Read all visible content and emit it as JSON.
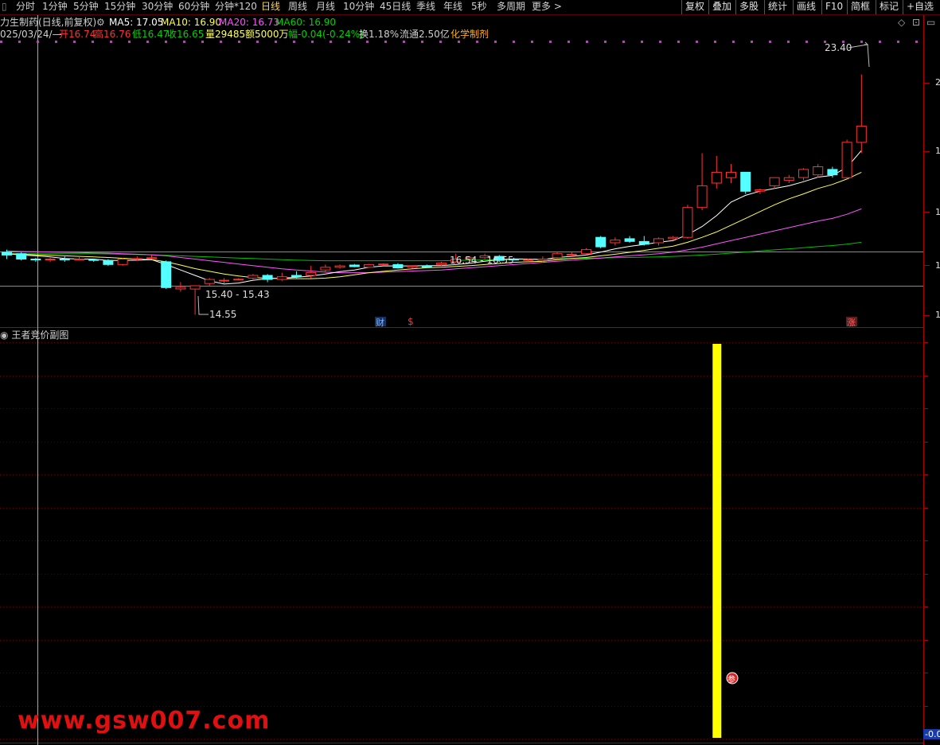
{
  "toolbar": {
    "left_items": [
      "分时",
      "1分钟",
      "5分钟",
      "15分钟",
      "30分钟",
      "60分钟",
      "分钟*120",
      "日线",
      "周线",
      "月线",
      "10分钟",
      "45日线",
      "季线",
      "年线",
      "5秒",
      "多周期",
      "更多 >"
    ],
    "active_item": "日线",
    "right_items": [
      "复权",
      "叠加",
      "多股",
      "统计",
      "画线",
      "F10",
      "简框",
      "标记",
      "+自选"
    ]
  },
  "title": {
    "stock_name": "力生制药(日线,前复权)",
    "ma5": "MA5: 17.05",
    "ma10": "MA10: 16.90",
    "ma20": "MA20: 16.73",
    "ma60": "MA60: 16.90"
  },
  "info": {
    "date": "025/03/24/—",
    "open": "开16.74",
    "high": "高16.76",
    "low": "低16.47",
    "close": "收16.65",
    "volume": "量29485",
    "amount": "额5000万",
    "change": "幅-0.04(-0.24%)",
    "turnover": "换1.18%",
    "float": "流通2.50亿",
    "sector": "化学制剂"
  },
  "annotations": {
    "high_price": "23.40",
    "low_price": "14.55",
    "range1": "15.40 - 15.43",
    "range2": "16.54 - 16.55",
    "marker_cai": "财",
    "marker_dollar": "$",
    "marker_zhang": "涨",
    "marker_shen": "参"
  },
  "right_axis": {
    "labels": [
      "2",
      "1",
      "1",
      "1",
      "1"
    ],
    "bottom_value": "-0.0"
  },
  "sub_chart": {
    "title": "王者竞价副图"
  },
  "watermark": "www.gsw007.com",
  "colors": {
    "up": "#ff3232",
    "down": "#54ffff",
    "ma5": "#ffffff",
    "ma10": "#ffff54",
    "ma20": "#ff54ff",
    "ma60": "#00c000",
    "signal_bar": "#ffff00"
  },
  "chart_data": {
    "type": "candlestick",
    "candles": [
      {
        "o": 16.85,
        "h": 16.95,
        "l": 16.6,
        "c": 16.75
      },
      {
        "o": 16.8,
        "h": 16.85,
        "l": 16.55,
        "c": 16.6
      },
      {
        "o": 16.6,
        "h": 16.65,
        "l": 16.5,
        "c": 16.58
      },
      {
        "o": 16.58,
        "h": 16.65,
        "l": 16.5,
        "c": 16.6
      },
      {
        "o": 16.6,
        "h": 16.7,
        "l": 16.5,
        "c": 16.58
      },
      {
        "o": 16.57,
        "h": 16.7,
        "l": 16.55,
        "c": 16.6
      },
      {
        "o": 16.58,
        "h": 16.62,
        "l": 16.5,
        "c": 16.55
      },
      {
        "o": 16.55,
        "h": 16.6,
        "l": 16.35,
        "c": 16.4
      },
      {
        "o": 16.4,
        "h": 16.65,
        "l": 16.35,
        "c": 16.6
      },
      {
        "o": 16.6,
        "h": 16.7,
        "l": 16.55,
        "c": 16.62
      },
      {
        "o": 16.62,
        "h": 16.75,
        "l": 16.6,
        "c": 16.65
      },
      {
        "o": 16.5,
        "h": 16.55,
        "l": 15.5,
        "c": 15.55
      },
      {
        "o": 15.5,
        "h": 15.75,
        "l": 15.4,
        "c": 15.56
      },
      {
        "o": 15.5,
        "h": 15.6,
        "l": 14.55,
        "c": 15.62
      },
      {
        "o": 15.7,
        "h": 15.9,
        "l": 15.6,
        "c": 15.85
      },
      {
        "o": 15.8,
        "h": 15.9,
        "l": 15.7,
        "c": 15.82
      },
      {
        "o": 15.85,
        "h": 15.9,
        "l": 15.82,
        "c": 15.86
      },
      {
        "o": 15.9,
        "h": 16.05,
        "l": 15.85,
        "c": 16.0
      },
      {
        "o": 16.0,
        "h": 16.05,
        "l": 15.75,
        "c": 15.85
      },
      {
        "o": 15.85,
        "h": 16.1,
        "l": 15.8,
        "c": 15.95
      },
      {
        "o": 16.0,
        "h": 16.15,
        "l": 15.9,
        "c": 15.95
      },
      {
        "o": 16.0,
        "h": 16.35,
        "l": 15.9,
        "c": 16.1
      },
      {
        "o": 16.2,
        "h": 16.4,
        "l": 16.1,
        "c": 16.3
      },
      {
        "o": 16.3,
        "h": 16.4,
        "l": 16.25,
        "c": 16.35
      },
      {
        "o": 16.38,
        "h": 16.42,
        "l": 16.3,
        "c": 16.32
      },
      {
        "o": 16.3,
        "h": 16.42,
        "l": 16.28,
        "c": 16.4
      },
      {
        "o": 16.4,
        "h": 16.45,
        "l": 16.35,
        "c": 16.42
      },
      {
        "o": 16.4,
        "h": 16.45,
        "l": 16.25,
        "c": 16.28
      },
      {
        "o": 16.3,
        "h": 16.38,
        "l": 16.25,
        "c": 16.34
      },
      {
        "o": 16.35,
        "h": 16.4,
        "l": 16.28,
        "c": 16.3
      },
      {
        "o": 16.4,
        "h": 16.5,
        "l": 16.35,
        "c": 16.45
      },
      {
        "o": 16.5,
        "h": 16.8,
        "l": 16.45,
        "c": 16.6
      },
      {
        "o": 16.6,
        "h": 16.7,
        "l": 16.55,
        "c": 16.65
      },
      {
        "o": 16.65,
        "h": 16.8,
        "l": 16.6,
        "c": 16.72
      },
      {
        "o": 16.7,
        "h": 16.75,
        "l": 16.5,
        "c": 16.55
      },
      {
        "o": 16.6,
        "h": 16.65,
        "l": 16.55,
        "c": 16.57
      },
      {
        "o": 16.55,
        "h": 16.62,
        "l": 16.5,
        "c": 16.58
      },
      {
        "o": 16.55,
        "h": 16.7,
        "l": 16.5,
        "c": 16.6
      },
      {
        "o": 16.65,
        "h": 16.85,
        "l": 16.6,
        "c": 16.8
      },
      {
        "o": 16.75,
        "h": 16.85,
        "l": 16.7,
        "c": 16.78
      },
      {
        "o": 16.8,
        "h": 17.0,
        "l": 16.75,
        "c": 16.95
      },
      {
        "o": 17.4,
        "h": 17.45,
        "l": 17.0,
        "c": 17.05
      },
      {
        "o": 17.2,
        "h": 17.4,
        "l": 17.1,
        "c": 17.3
      },
      {
        "o": 17.35,
        "h": 17.45,
        "l": 17.2,
        "c": 17.25
      },
      {
        "o": 17.25,
        "h": 17.45,
        "l": 17.1,
        "c": 17.15
      },
      {
        "o": 17.2,
        "h": 17.4,
        "l": 17.1,
        "c": 17.35
      },
      {
        "o": 17.35,
        "h": 17.45,
        "l": 17.3,
        "c": 17.4
      },
      {
        "o": 17.4,
        "h": 18.6,
        "l": 17.35,
        "c": 18.5
      },
      {
        "o": 18.5,
        "h": 20.5,
        "l": 18.4,
        "c": 19.3
      },
      {
        "o": 19.4,
        "h": 20.4,
        "l": 19.2,
        "c": 19.8
      },
      {
        "o": 19.6,
        "h": 20.1,
        "l": 19.4,
        "c": 19.8
      },
      {
        "o": 19.8,
        "h": 19.8,
        "l": 19.0,
        "c": 19.1
      },
      {
        "o": 19.1,
        "h": 19.2,
        "l": 19.0,
        "c": 19.15
      },
      {
        "o": 19.3,
        "h": 19.6,
        "l": 19.2,
        "c": 19.6
      },
      {
        "o": 19.5,
        "h": 19.7,
        "l": 19.4,
        "c": 19.6
      },
      {
        "o": 19.6,
        "h": 19.95,
        "l": 19.5,
        "c": 19.9
      },
      {
        "o": 19.7,
        "h": 20.1,
        "l": 19.6,
        "c": 20.0
      },
      {
        "o": 19.9,
        "h": 20.0,
        "l": 19.6,
        "c": 19.7
      },
      {
        "o": 19.6,
        "h": 21.0,
        "l": 19.55,
        "c": 20.9
      },
      {
        "o": 20.9,
        "h": 23.4,
        "l": 20.5,
        "c": 21.5
      }
    ],
    "ma5": [
      16.8,
      16.75,
      16.72,
      16.68,
      16.62,
      16.6,
      16.6,
      16.55,
      16.55,
      16.56,
      16.58,
      16.4,
      16.2,
      16.0,
      15.8,
      15.68,
      15.72,
      15.82,
      15.88,
      15.9,
      15.93,
      15.98,
      16.05,
      16.14,
      16.2,
      16.3,
      16.35,
      16.35,
      16.35,
      16.36,
      16.36,
      16.4,
      16.45,
      16.52,
      16.58,
      16.61,
      16.6,
      16.58,
      16.66,
      16.7,
      16.75,
      16.86,
      16.98,
      17.07,
      17.14,
      17.22,
      17.28,
      17.5,
      17.8,
      18.2,
      18.7,
      18.95,
      19.1,
      19.2,
      19.3,
      19.45,
      19.62,
      19.68,
      19.98,
      20.6
    ],
    "ma10": [
      16.8,
      16.78,
      16.76,
      16.74,
      16.72,
      16.7,
      16.68,
      16.66,
      16.63,
      16.6,
      16.58,
      16.5,
      16.38,
      16.25,
      16.15,
      16.05,
      15.98,
      15.92,
      15.9,
      15.88,
      15.88,
      15.88,
      15.9,
      15.95,
      16.02,
      16.1,
      16.15,
      16.2,
      16.24,
      16.28,
      16.3,
      16.33,
      16.36,
      16.4,
      16.44,
      16.48,
      16.5,
      16.52,
      16.58,
      16.62,
      16.66,
      16.72,
      16.78,
      16.85,
      16.92,
      17.0,
      17.08,
      17.22,
      17.4,
      17.6,
      17.85,
      18.1,
      18.35,
      18.6,
      18.82,
      19.0,
      19.2,
      19.35,
      19.55,
      19.8
    ],
    "ma20": [
      16.9,
      16.88,
      16.87,
      16.86,
      16.85,
      16.84,
      16.83,
      16.82,
      16.8,
      16.78,
      16.76,
      16.72,
      16.66,
      16.6,
      16.54,
      16.48,
      16.42,
      16.36,
      16.3,
      16.24,
      16.2,
      16.16,
      16.12,
      16.1,
      16.1,
      16.1,
      16.12,
      16.14,
      16.16,
      16.18,
      16.2,
      16.24,
      16.28,
      16.32,
      16.36,
      16.4,
      16.44,
      16.48,
      16.52,
      16.56,
      16.6,
      16.64,
      16.68,
      16.72,
      16.76,
      16.8,
      16.86,
      16.94,
      17.04,
      17.16,
      17.28,
      17.4,
      17.52,
      17.64,
      17.76,
      17.88,
      18.0,
      18.1,
      18.25,
      18.45
    ],
    "ma60": [
      16.8,
      16.8,
      16.8,
      16.8,
      16.8,
      16.8,
      16.8,
      16.79,
      16.78,
      16.77,
      16.76,
      16.74,
      16.72,
      16.7,
      16.68,
      16.66,
      16.64,
      16.62,
      16.6,
      16.58,
      16.56,
      16.55,
      16.54,
      16.54,
      16.54,
      16.54,
      16.54,
      16.54,
      16.54,
      16.54,
      16.54,
      16.55,
      16.56,
      16.57,
      16.58,
      16.59,
      16.6,
      16.6,
      16.61,
      16.62,
      16.63,
      16.64,
      16.65,
      16.66,
      16.67,
      16.68,
      16.7,
      16.72,
      16.75,
      16.78,
      16.82,
      16.86,
      16.9,
      16.94,
      16.98,
      17.02,
      17.06,
      17.1,
      17.15,
      17.22
    ],
    "signal_bars": [
      {
        "index": 49,
        "value": 1
      }
    ],
    "y_range": [
      14.3,
      24.5
    ]
  }
}
